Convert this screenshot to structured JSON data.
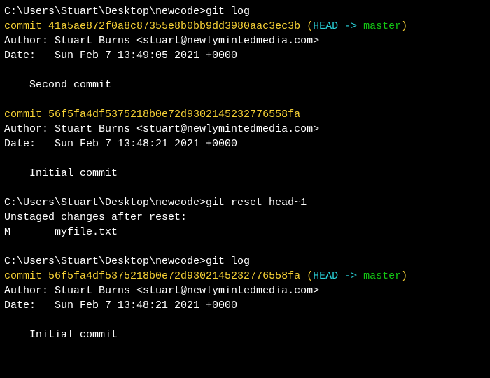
{
  "block1": {
    "prompt": "C:\\Users\\Stuart\\Desktop\\newcode>",
    "cmd": "git log",
    "commit_label": "commit ",
    "commit_hash": "41a5ae872f0a8c87355e8b0bb9dd3980aac3ec3b",
    "ref_open": " (",
    "ref_head": "HEAD -> ",
    "ref_branch": "master",
    "ref_close": ")",
    "author": "Author: Stuart Burns <stuart@newlymintedmedia.com>",
    "date": "Date:   Sun Feb 7 13:49:05 2021 +0000",
    "message": "    Second commit"
  },
  "block2": {
    "commit_label": "commit ",
    "commit_hash": "56f5fa4df5375218b0e72d9302145232776558fa",
    "author": "Author: Stuart Burns <stuart@newlymintedmedia.com>",
    "date": "Date:   Sun Feb 7 13:48:21 2021 +0000",
    "message": "    Initial commit"
  },
  "block3": {
    "prompt": "C:\\Users\\Stuart\\Desktop\\newcode>",
    "cmd": "git reset head~1",
    "out1": "Unstaged changes after reset:",
    "out2": "M       myfile.txt"
  },
  "block4": {
    "prompt": "C:\\Users\\Stuart\\Desktop\\newcode>",
    "cmd": "git log",
    "commit_label": "commit ",
    "commit_hash": "56f5fa4df5375218b0e72d9302145232776558fa",
    "ref_open": " (",
    "ref_head": "HEAD -> ",
    "ref_branch": "master",
    "ref_close": ")",
    "author": "Author: Stuart Burns <stuart@newlymintedmedia.com>",
    "date": "Date:   Sun Feb 7 13:48:21 2021 +0000",
    "message": "    Initial commit"
  }
}
